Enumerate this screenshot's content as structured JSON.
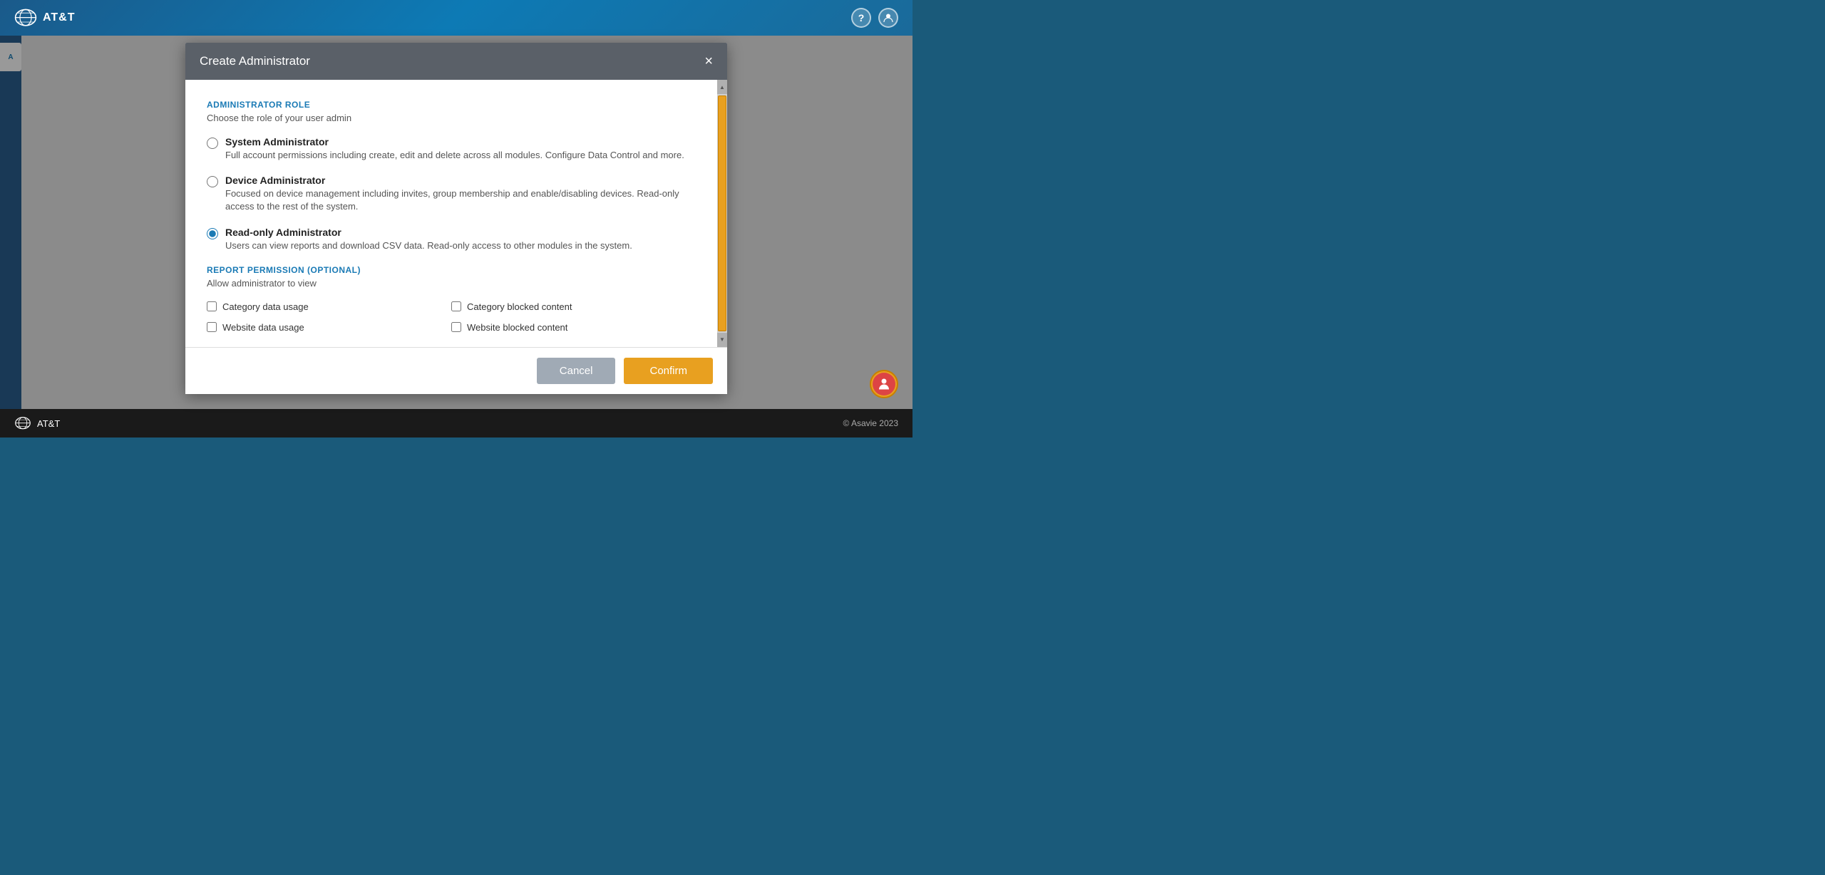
{
  "topbar": {
    "app_name": "AT&T",
    "help_icon": "?",
    "user_icon": "👤"
  },
  "modal": {
    "title": "Create Administrator",
    "close_label": "×",
    "admin_role_section": {
      "label": "ADMINISTRATOR ROLE",
      "subtitle": "Choose the role of your user admin",
      "options": [
        {
          "id": "system-admin",
          "title": "System Administrator",
          "description": "Full account permissions including create, edit and delete across all modules. Configure Data Control and more.",
          "selected": false
        },
        {
          "id": "device-admin",
          "title": "Device Administrator",
          "description": "Focused on device management including invites, group membership and enable/disabling devices. Read-only access to the rest of the system.",
          "selected": false
        },
        {
          "id": "readonly-admin",
          "title": "Read-only Administrator",
          "description": "Users can view reports and download CSV data. Read-only access to other modules in the system.",
          "selected": true
        }
      ]
    },
    "report_permission_section": {
      "label": "REPORT PERMISSION (OPTIONAL)",
      "subtitle": "Allow administrator to view",
      "checkboxes": [
        {
          "id": "category-data-usage",
          "label": "Category data usage",
          "checked": false
        },
        {
          "id": "category-blocked-content",
          "label": "Category blocked content",
          "checked": false
        },
        {
          "id": "website-data-usage",
          "label": "Website data usage",
          "checked": false
        },
        {
          "id": "website-blocked-content",
          "label": "Website blocked content",
          "checked": false
        }
      ]
    },
    "footer": {
      "cancel_label": "Cancel",
      "confirm_label": "Confirm"
    }
  },
  "bottombar": {
    "brand": "AT&T",
    "copyright": "© Asavie 2023"
  }
}
